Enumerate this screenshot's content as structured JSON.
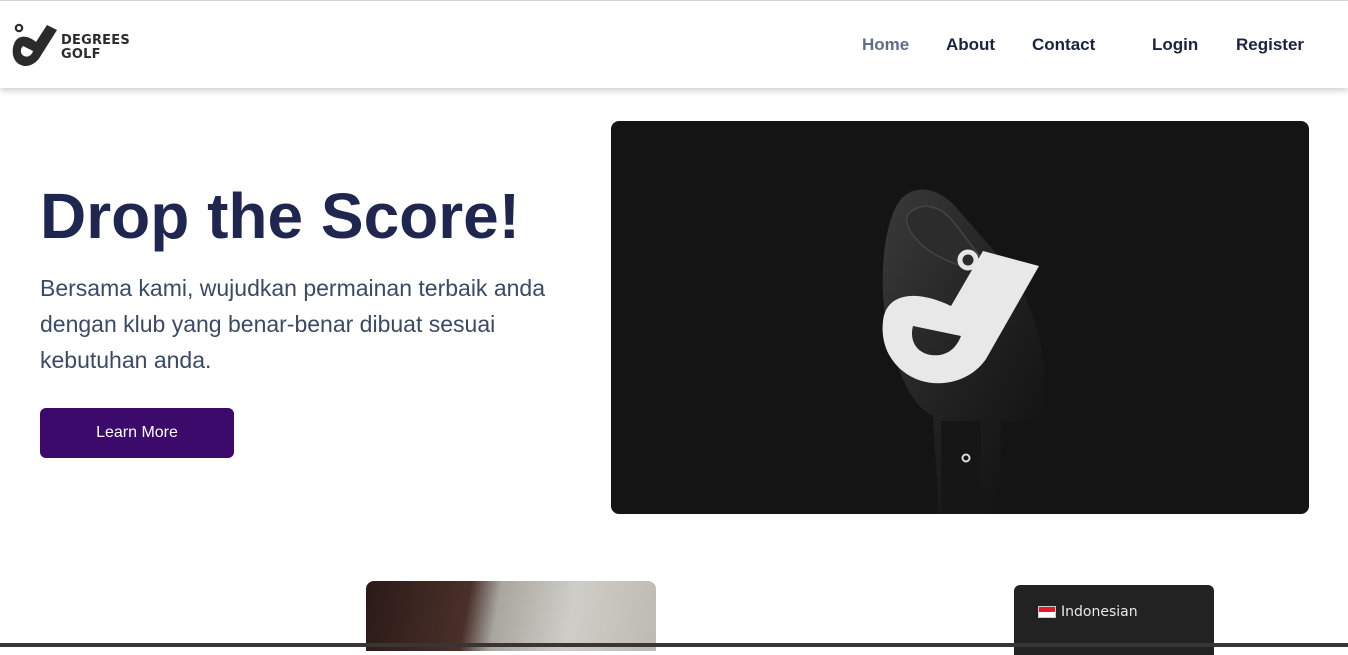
{
  "brand": {
    "name_line1": "DEGREES",
    "name_line2": "GOLF"
  },
  "nav": {
    "home": "Home",
    "about": "About",
    "contact": "Contact",
    "login": "Login",
    "register": "Register"
  },
  "hero": {
    "title": "Drop the Score!",
    "description": "Bersama kami, wujudkan permainan terbaik anda dengan klub yang benar-benar dibuat sesuai kebutuhan anda.",
    "cta": "Learn More"
  },
  "language": {
    "selected": "Indonesian"
  },
  "colors": {
    "title": "#1f2750",
    "button": "#3b0a6b",
    "nav_active": "#5f6f86",
    "hero_bg": "#141414"
  },
  "icons": [
    "degrees-golf-logo-icon",
    "indonesia-flag-icon"
  ]
}
